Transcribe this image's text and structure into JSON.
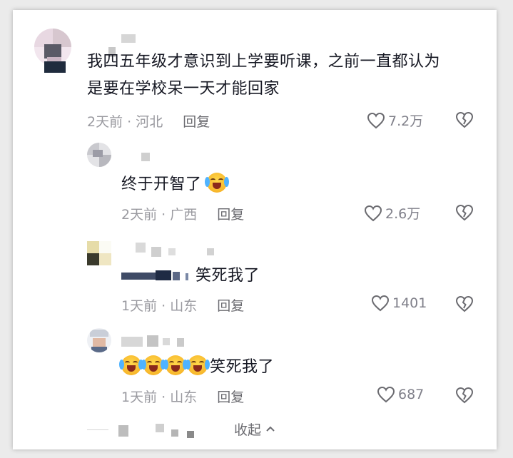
{
  "comments": [
    {
      "text_line1": "我四五年级才意识到上学要听课，之前一直都认为",
      "text_line2": "是要在学校呆一天才能回家",
      "time_location": "2天前 · 河北",
      "reply_label": "回复",
      "likes": "7.2万"
    },
    {
      "text": "终于开智了",
      "time_location": "2天前 · 广西",
      "reply_label": "回复",
      "likes": "2.6万"
    },
    {
      "text": "笑死我了",
      "time_location": "1天前 · 山东",
      "reply_label": "回复",
      "likes": "1401"
    },
    {
      "text": "笑死我了",
      "time_location": "1天前 · 山东",
      "reply_label": "回复",
      "likes": "687"
    }
  ],
  "collapse_label": "收起",
  "icons": {
    "like": "heart-outline-icon",
    "dislike": "broken-heart-icon",
    "emoji": "crying-laughing-emoji",
    "collapse": "chevron-up-icon"
  },
  "colors": {
    "text": "#161823",
    "meta": "#9a9aa0",
    "reply": "#6b6b70",
    "background": "#ffffff"
  }
}
